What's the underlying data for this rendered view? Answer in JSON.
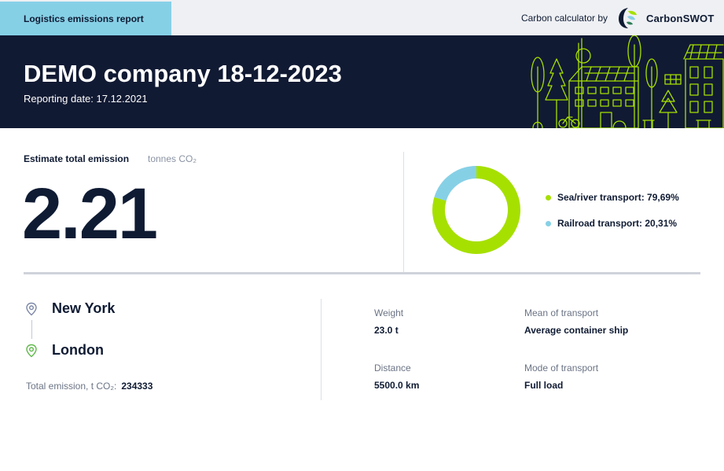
{
  "header": {
    "report_tab": "Logistics emissions report",
    "calculator_by": "Carbon calculator by",
    "brand_name": "CarbonSWOT"
  },
  "hero": {
    "title": "DEMO company 18-12-2023",
    "reporting_date": "Reporting date: 17.12.2021"
  },
  "summary": {
    "label": "Estimate total emission",
    "unit": "tonnes CO₂",
    "value": "2.21"
  },
  "chart_data": {
    "type": "pie",
    "donut": true,
    "categories": [
      "Sea/river transport",
      "Railroad transport"
    ],
    "values": [
      79.69,
      20.31
    ],
    "colors": [
      "#a6e000",
      "#86d0e6"
    ],
    "legend": [
      "Sea/river transport: 79,69%",
      "Railroad transport: 20,31%"
    ],
    "legend_position": "right"
  },
  "route": {
    "origin": "New York",
    "destination": "London",
    "total_label": "Total emission, t CO₂:",
    "total_value": "234333"
  },
  "details": {
    "weight_label": "Weight",
    "weight_value": "23.0 t",
    "mean_label": "Mean of transport",
    "mean_value": "Average container ship",
    "distance_label": "Distance",
    "distance_value": "5500.0 km",
    "mode_label": "Mode of transport",
    "mode_value": "Full load"
  },
  "colors": {
    "navy": "#111a33",
    "accent_blue": "#86d0e6",
    "accent_green": "#a6e000",
    "hero_art": "#a6e000"
  },
  "icons": [
    "carbonswot-logo-icon",
    "city-illustration",
    "location-pin-icon"
  ]
}
